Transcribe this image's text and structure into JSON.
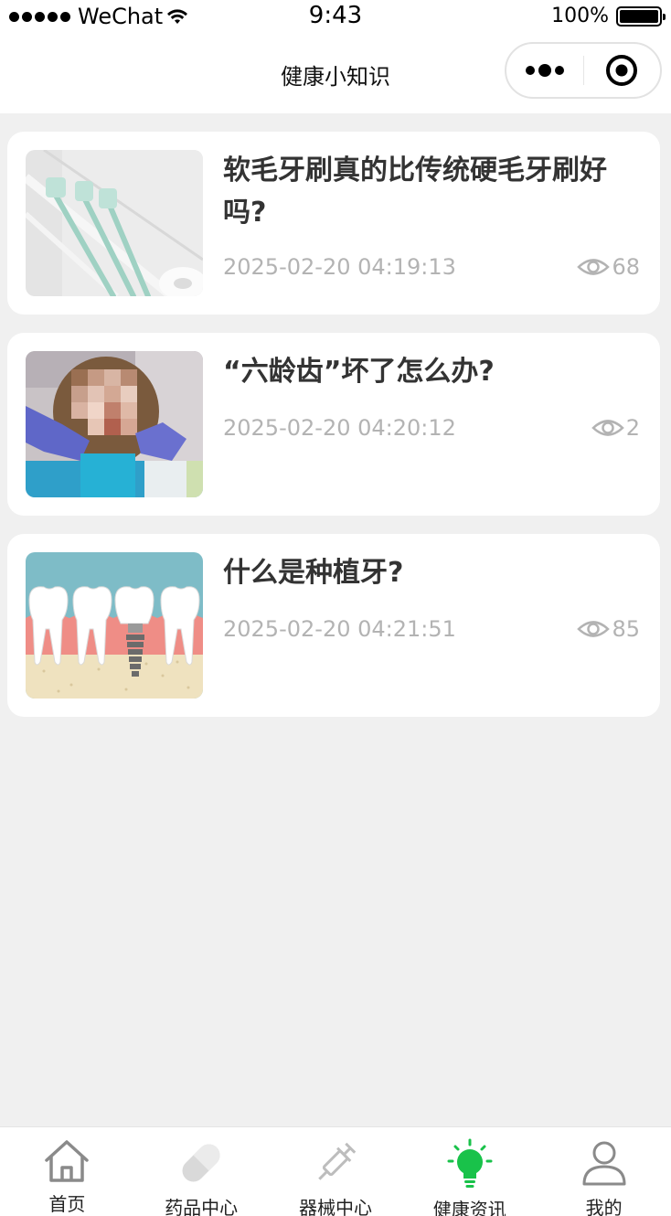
{
  "status_bar": {
    "carrier": "WeChat",
    "time": "9:43",
    "battery": "100%",
    "battery_level": 1.0
  },
  "nav": {
    "title": "健康小知识"
  },
  "articles": [
    {
      "title": "软毛牙刷真的比传统硬毛牙刷好吗?",
      "date": "2025-02-20 04:19:13",
      "views": "68",
      "image": "toothbrushes-photo"
    },
    {
      "title": "“六龄齿”坏了怎么办?",
      "date": "2025-02-20 04:20:12",
      "views": "2",
      "image": "child-dental-photo"
    },
    {
      "title": "什么是种植牙?",
      "date": "2025-02-20 04:21:51",
      "views": "85",
      "image": "dental-implant-illustration"
    }
  ],
  "tabs": [
    {
      "label": "首页",
      "icon": "home-icon",
      "active": false
    },
    {
      "label": "药品中心",
      "icon": "pill-icon",
      "active": false
    },
    {
      "label": "器械中心",
      "icon": "syringe-icon",
      "active": false
    },
    {
      "label": "健康资讯",
      "icon": "lightbulb-icon",
      "active": true
    },
    {
      "label": "我的",
      "icon": "user-icon",
      "active": false
    }
  ],
  "colors": {
    "active_tab": "#19c24a",
    "inactive_icon": "#8a8a8a",
    "meta_text": "#b3b3b3",
    "background": "#f0f0f0"
  }
}
